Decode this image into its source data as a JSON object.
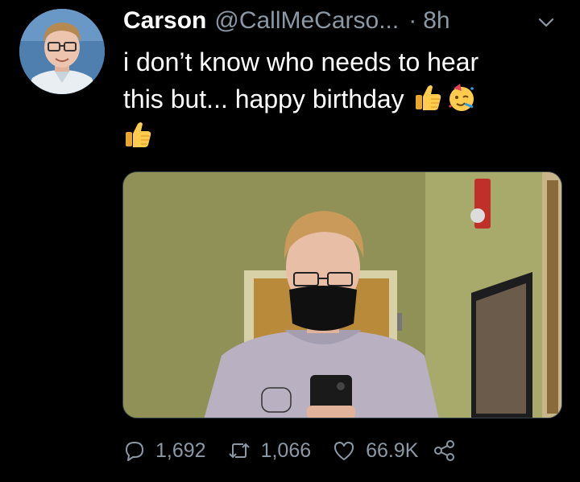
{
  "tweet": {
    "display_name": "Carson",
    "handle": "@CallMeCarso...",
    "separator": "·",
    "time": "8h",
    "text_line1": "i don’t know who needs to hear",
    "text_line2": "this but... happy birthday",
    "emojis": [
      "thumbs-up-icon",
      "partying-face-icon",
      "thumbs-up-icon"
    ],
    "media": {
      "alt": "mirror selfie"
    }
  },
  "actions": {
    "replies": "1,692",
    "retweets": "1,066",
    "likes": "66.9K"
  },
  "colors": {
    "background": "#000000",
    "text": "#ffffff",
    "secondary": "#8b98a5"
  }
}
